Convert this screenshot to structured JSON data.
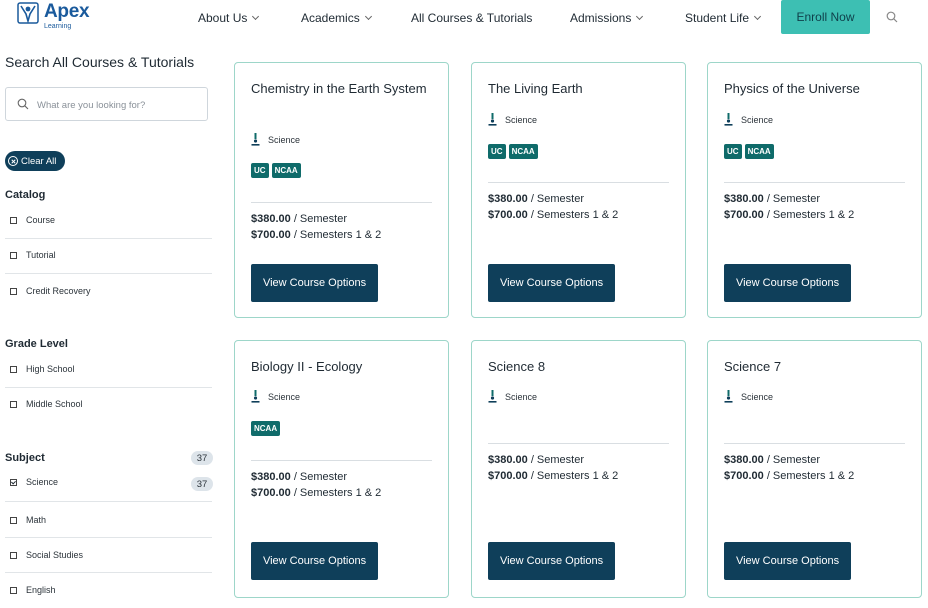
{
  "header": {
    "logo_name": "Apex",
    "logo_sub": "Learning",
    "nav": [
      {
        "label": "About Us",
        "dropdown": true
      },
      {
        "label": "Academics",
        "dropdown": true
      },
      {
        "label": "All Courses & Tutorials",
        "dropdown": false
      },
      {
        "label": "Admissions",
        "dropdown": true
      },
      {
        "label": "Student Life",
        "dropdown": true
      }
    ],
    "enroll_label": "Enroll Now",
    "icons": {
      "search": "search-icon"
    }
  },
  "sidebar": {
    "title": "Search All Courses & Tutorials",
    "search_placeholder": "What are you looking for?",
    "clear_all": "Clear All",
    "groups": [
      {
        "title": "Catalog",
        "options": [
          {
            "label": "Course",
            "checked": false
          },
          {
            "label": "Tutorial",
            "checked": false
          },
          {
            "label": "Credit Recovery",
            "checked": false
          }
        ]
      },
      {
        "title": "Grade Level",
        "options": [
          {
            "label": "High School",
            "checked": false
          },
          {
            "label": "Middle School",
            "checked": false
          }
        ]
      },
      {
        "title": "Subject",
        "count": "37",
        "options": [
          {
            "label": "Science",
            "checked": true,
            "count": "37"
          },
          {
            "label": "Math",
            "checked": false
          },
          {
            "label": "Social Studies",
            "checked": false
          },
          {
            "label": "English",
            "checked": false
          }
        ]
      }
    ]
  },
  "courses": [
    {
      "title": "Chemistry in the Earth System",
      "subject": "Science",
      "tags": [
        "UC",
        "NCAA"
      ],
      "price_semester": "$380.00",
      "price_semester_unit": " / Semester",
      "price_full": "$700.00",
      "price_full_unit": " / Semesters 1 & 2",
      "button": "View Course Options"
    },
    {
      "title": "The Living Earth",
      "subject": "Science",
      "tags": [
        "UC",
        "NCAA"
      ],
      "price_semester": "$380.00",
      "price_semester_unit": " / Semester",
      "price_full": "$700.00",
      "price_full_unit": " / Semesters 1 & 2",
      "button": "View Course Options"
    },
    {
      "title": "Physics of the Universe",
      "subject": "Science",
      "tags": [
        "UC",
        "NCAA"
      ],
      "price_semester": "$380.00",
      "price_semester_unit": " / Semester",
      "price_full": "$700.00",
      "price_full_unit": " / Semesters 1 & 2",
      "button": "View Course Options"
    },
    {
      "title": "Biology II - Ecology",
      "subject": "Science",
      "tags": [
        "NCAA"
      ],
      "price_semester": "$380.00",
      "price_semester_unit": " / Semester",
      "price_full": "$700.00",
      "price_full_unit": " / Semesters 1 & 2",
      "button": "View Course Options"
    },
    {
      "title": "Science 8",
      "subject": "Science",
      "tags": [],
      "price_semester": "$380.00",
      "price_semester_unit": " / Semester",
      "price_full": "$700.00",
      "price_full_unit": " / Semesters 1 & 2",
      "button": "View Course Options"
    },
    {
      "title": "Science 7",
      "subject": "Science",
      "tags": [],
      "price_semester": "$380.00",
      "price_semester_unit": " / Semester",
      "price_full": "$700.00",
      "price_full_unit": " / Semesters 1 & 2",
      "button": "View Course Options"
    }
  ],
  "colors": {
    "accent": "#3dbfb3",
    "primary": "#0f3f5a",
    "tag": "#0f6b6a",
    "card_border": "#9dd6c9"
  }
}
